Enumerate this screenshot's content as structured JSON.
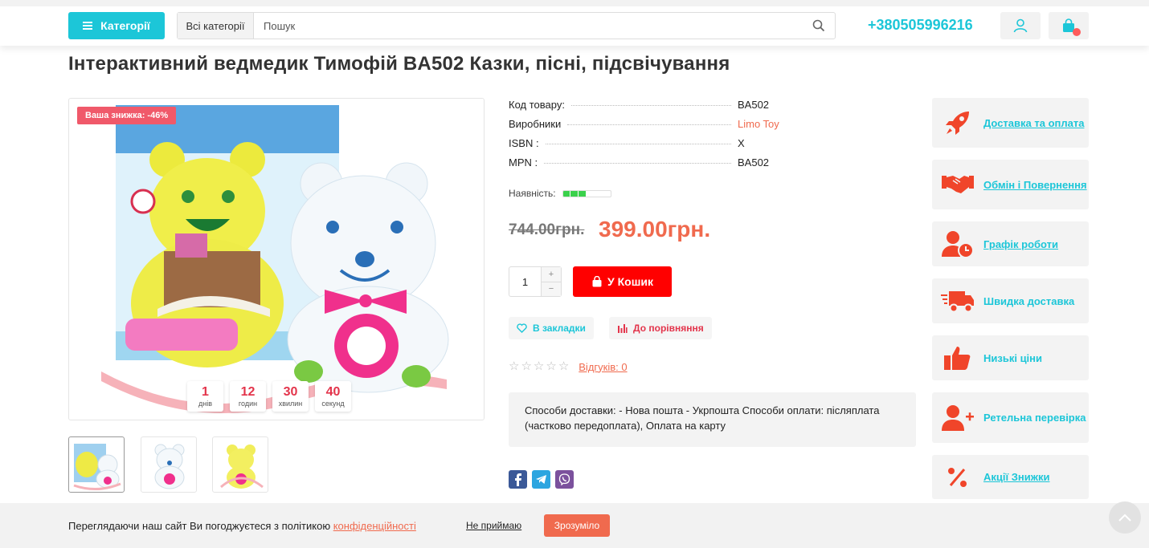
{
  "header": {
    "categories_label": "Категорії",
    "search_category": "Всі категорії",
    "search_placeholder": "Пошук",
    "phone": "+380505996216",
    "accent_color": "#1cc6d8"
  },
  "product": {
    "title": "Інтерактивний ведмедик Тимофій BA502 Казки, пісні, підсвічування",
    "discount_badge": "Ваша знижка: -46%",
    "timer": [
      {
        "value": "1",
        "label": "днів"
      },
      {
        "value": "12",
        "label": "годин"
      },
      {
        "value": "30",
        "label": "хвилин"
      },
      {
        "value": "40",
        "label": "секунд"
      }
    ],
    "specs": [
      {
        "label": "Код товару:",
        "value": "BA502"
      },
      {
        "label": "Виробники",
        "value": "Limo Toy"
      },
      {
        "label": "ISBN :",
        "value": "X"
      },
      {
        "label": "MPN :",
        "value": "BA502"
      }
    ],
    "availability_label": "Наявність:",
    "availability_level": 0.5,
    "old_price": "744.00грн.",
    "new_price": "399.00грн.",
    "quantity": "1",
    "qty_plus": "+",
    "qty_minus": "−",
    "buy_label": "У Кошик",
    "wishlist_label": "В закладки",
    "compare_label": "До порівняння",
    "rating": 0,
    "reviews_label": "Відгуків: 0",
    "shipping_text": "Способи доставки: - Нова пошта - Укрпошта Способи оплати: післяплата (частково передоплата), Оплата на карту",
    "price_color": "#f06a4e"
  },
  "sidebar": [
    {
      "label": "Доставка та оплата",
      "icon": "rocket-icon"
    },
    {
      "label": "Обмін і Повернення",
      "icon": "handshake-icon"
    },
    {
      "label": "Графік роботи",
      "icon": "user-clock-icon"
    },
    {
      "label": "Швидка доставка",
      "icon": "truck-icon"
    },
    {
      "label": "Низькі ціни",
      "icon": "thumbs-up-icon"
    },
    {
      "label": "Ретельна перевірка",
      "icon": "user-plus-icon"
    },
    {
      "label": "Акції Знижки",
      "icon": "percent-icon"
    }
  ],
  "cookie": {
    "text": "Переглядаючи наш сайт Ви погоджуєтеся з політикою",
    "link": "конфіденційності",
    "decline": "Не приймаю",
    "accept": "Зрозуміло"
  }
}
